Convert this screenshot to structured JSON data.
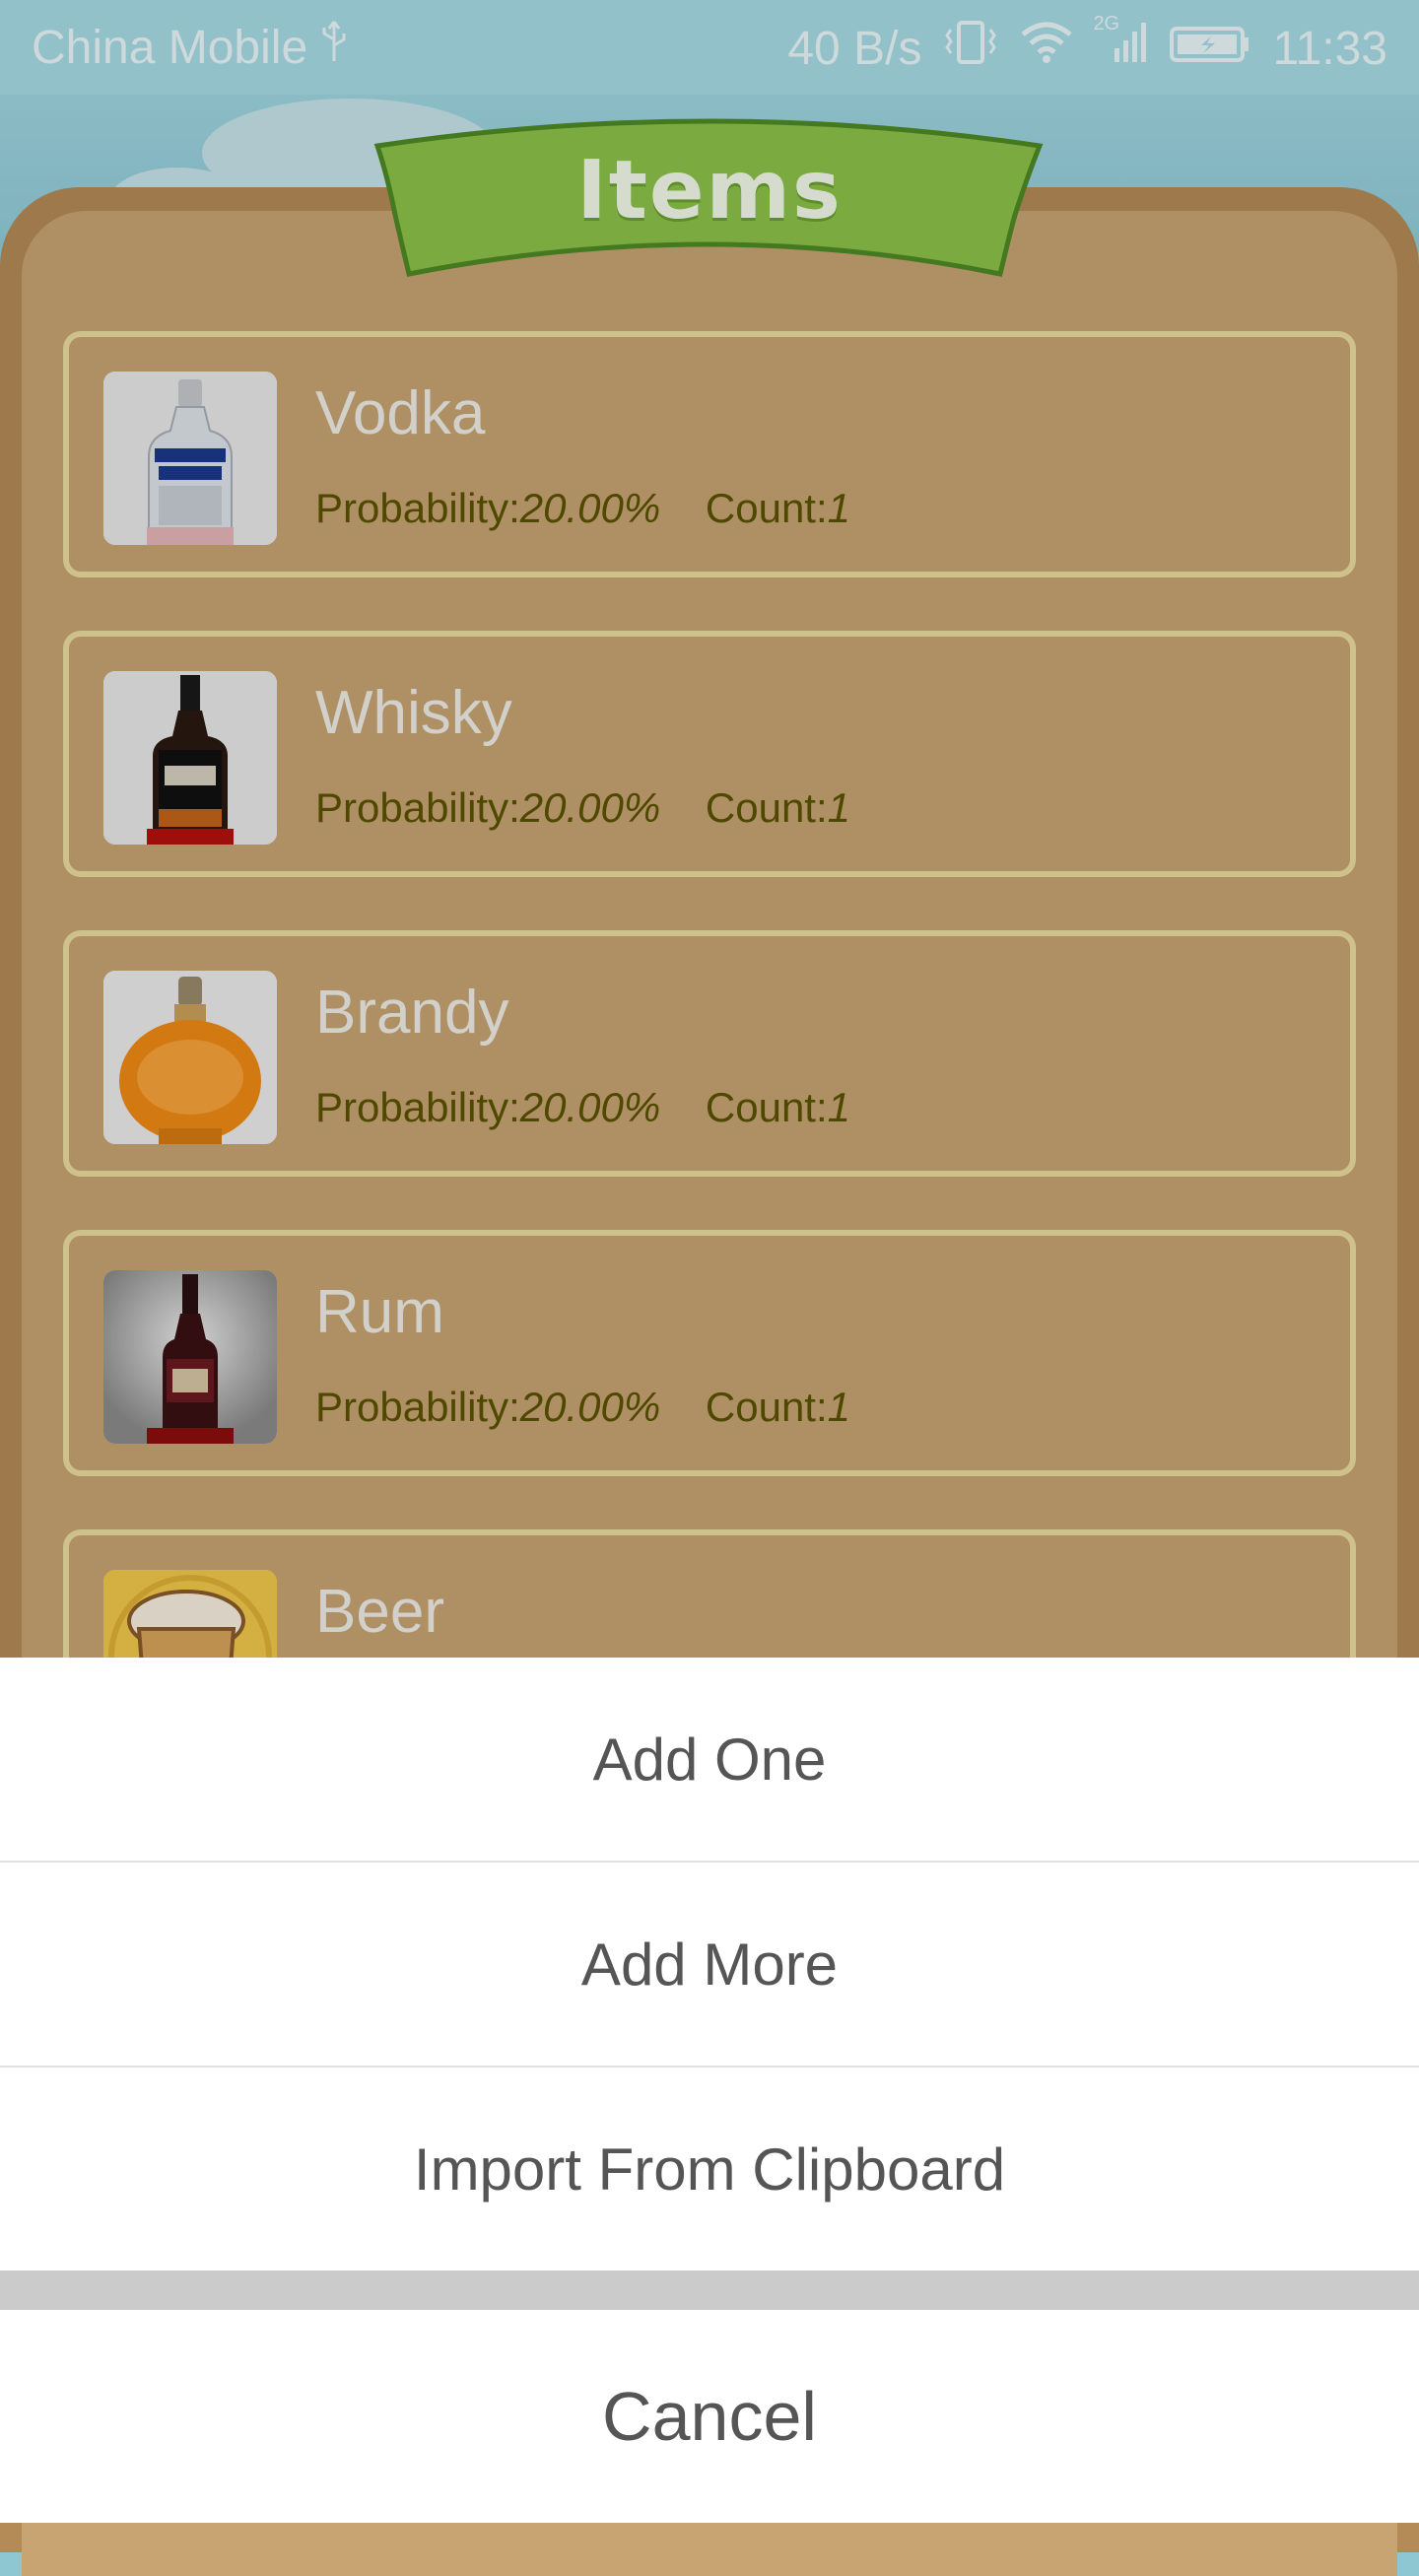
{
  "status_bar": {
    "carrier": "China Mobile",
    "net_speed": "40 B/s",
    "network_type": "2G",
    "time": "11:33"
  },
  "banner": {
    "title": "Items"
  },
  "items": [
    {
      "name": "Vodka",
      "probability_label": "Probability:",
      "probability": "20.00%",
      "count_label": "Count:",
      "count": "1"
    },
    {
      "name": "Whisky",
      "probability_label": "Probability:",
      "probability": "20.00%",
      "count_label": "Count:",
      "count": "1"
    },
    {
      "name": "Brandy",
      "probability_label": "Probability:",
      "probability": "20.00%",
      "count_label": "Count:",
      "count": "1"
    },
    {
      "name": "Rum",
      "probability_label": "Probability:",
      "probability": "20.00%",
      "count_label": "Count:",
      "count": "1"
    },
    {
      "name": "Beer"
    }
  ],
  "action_sheet": {
    "add_one": "Add One",
    "add_more": "Add More",
    "import_clipboard": "Import From Clipboard",
    "cancel": "Cancel"
  },
  "colors": {
    "board": "#c8a473",
    "banner_green": "#8dc249",
    "item_border": "#ebdca0",
    "meta_text": "#5a5200"
  }
}
